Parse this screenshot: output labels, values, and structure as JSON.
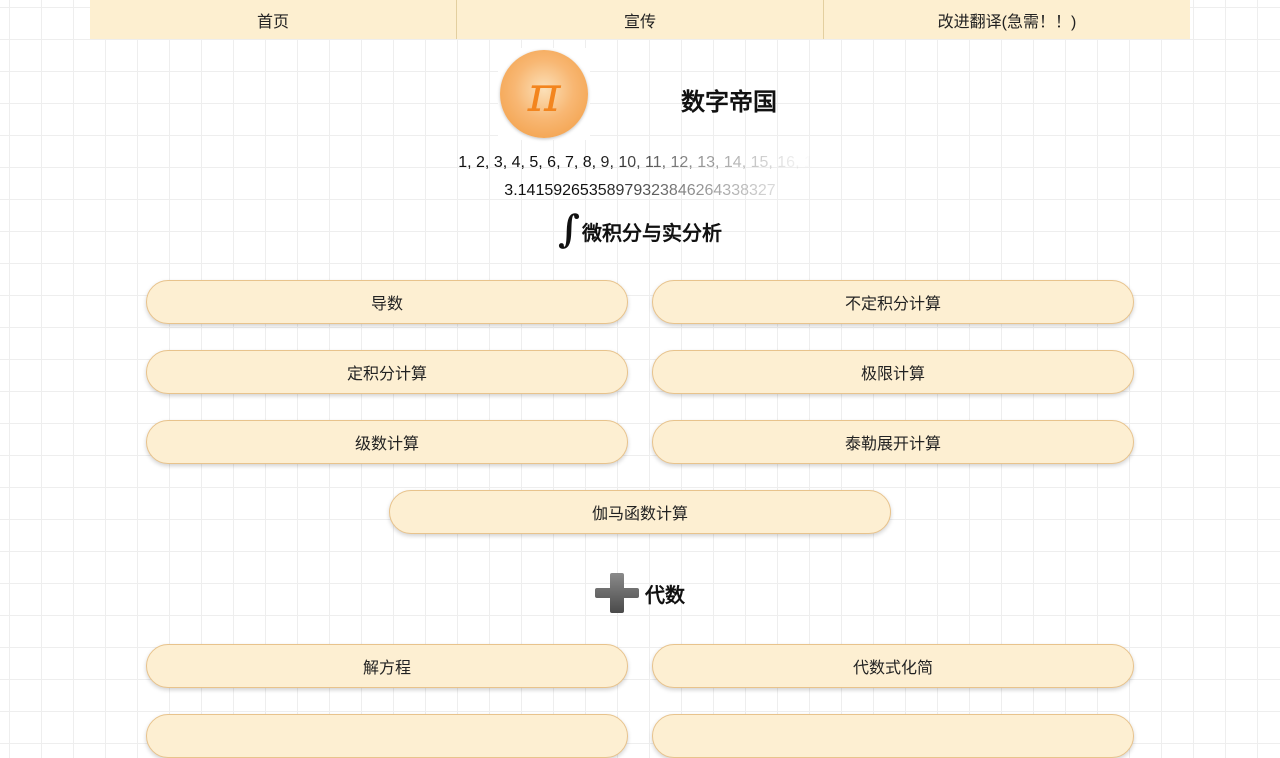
{
  "nav": {
    "items": [
      {
        "label": "首页"
      },
      {
        "label": "宣传"
      },
      {
        "label": "改进翻译(急需！！)"
      }
    ]
  },
  "header": {
    "logo_symbol": "π",
    "title": "数字帝国",
    "ticker_numbers": "1, 2, 3, 4, 5, 6, 7, 8, 9, 10, 11, 12, 13, 14, 15, 16, 17",
    "ticker_pi": "3.14159265358979323846264338327"
  },
  "sections": {
    "calculus": {
      "icon": "integral-icon",
      "title": "微积分与实分析",
      "buttons": [
        "导数",
        "不定积分计算",
        "定积分计算",
        "极限计算",
        "级数计算",
        "泰勒展开计算",
        "伽马函数计算"
      ]
    },
    "algebra": {
      "icon": "plus-icon",
      "title": "代数",
      "buttons": [
        "解方程",
        "代数式化简"
      ]
    }
  },
  "colors": {
    "nav_background": "#fdefd0",
    "button_background": "#fdefd2",
    "button_border": "#e8c38c",
    "logo_orange": "#f3851e",
    "plus_icon_gray": "#555555"
  }
}
